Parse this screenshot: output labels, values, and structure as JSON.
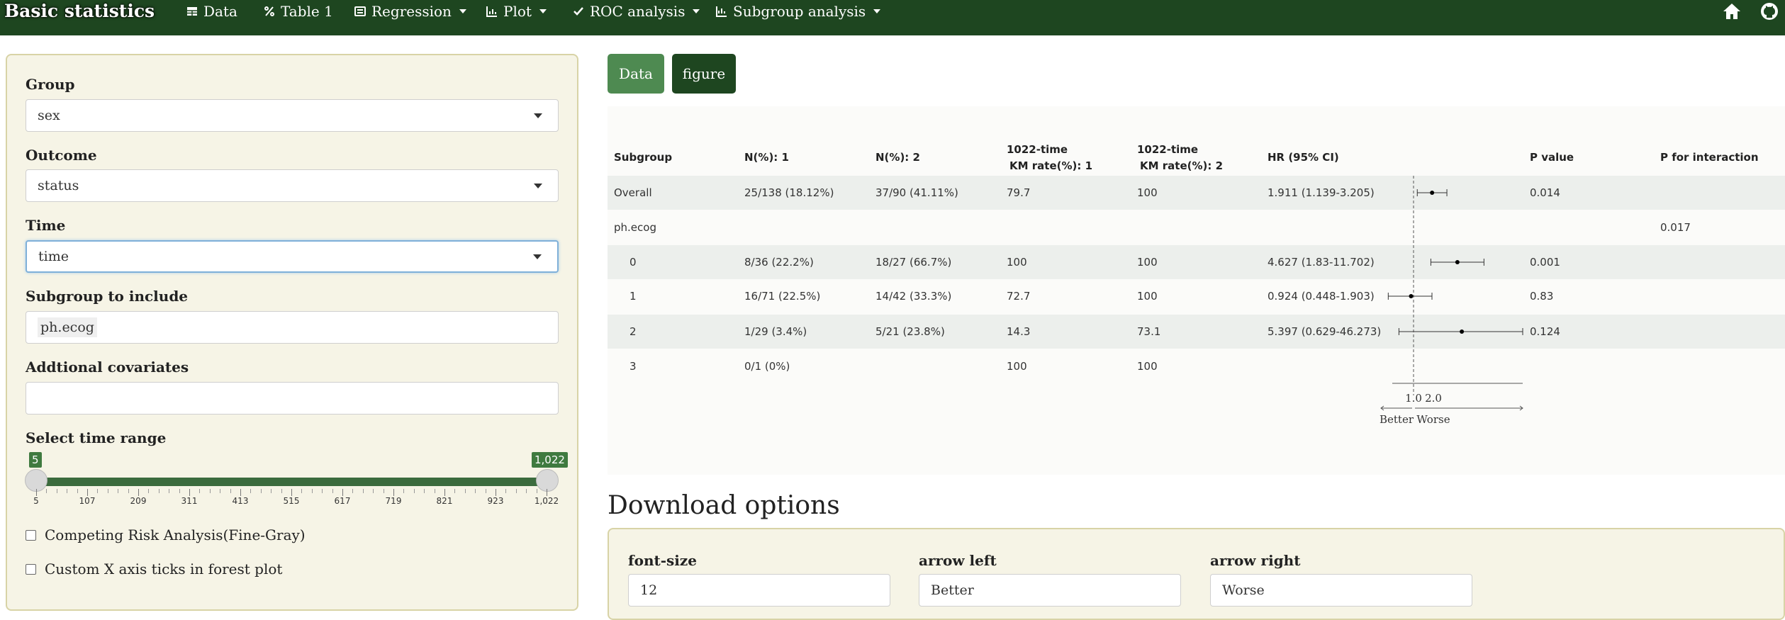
{
  "navbar": {
    "brand": "Basic statistics",
    "items": [
      {
        "label": "Data",
        "icon": "table-icon"
      },
      {
        "label": "Table 1",
        "icon": "percent-icon"
      },
      {
        "label": "Regression",
        "icon": "list-icon",
        "dropdown": true
      },
      {
        "label": "Plot",
        "icon": "bar-chart-icon",
        "dropdown": true
      },
      {
        "label": "ROC analysis",
        "icon": "check-icon",
        "dropdown": true
      },
      {
        "label": "Subgroup analysis",
        "icon": "line-chart-icon",
        "dropdown": true
      }
    ],
    "right_icons": [
      "home-icon",
      "github-icon"
    ]
  },
  "sidebar": {
    "group_label": "Group",
    "group_value": "sex",
    "outcome_label": "Outcome",
    "outcome_value": "status",
    "time_label": "Time",
    "time_value": "time",
    "subgroup_label": "Subgroup to include",
    "subgroup_tag": "ph.ecog",
    "covariates_label": "Addtional covariates",
    "covariates_value": "",
    "time_range_label": "Select time range",
    "slider": {
      "min": 5,
      "max": 1022,
      "from": 5,
      "to": 1022,
      "from_label": "5",
      "to_label": "1,022",
      "tick_labels": [
        "5",
        "107",
        "209",
        "311",
        "413",
        "515",
        "617",
        "719",
        "821",
        "923",
        "1,022"
      ]
    },
    "checkbox_competing": "Competing Risk Analysis(Fine-Gray)",
    "checkbox_custom_ticks": "Custom X axis ticks in forest plot"
  },
  "tabs": {
    "data": "Data",
    "figure": "figure"
  },
  "table": {
    "headers": {
      "subgroup": "Subgroup",
      "n1": "N(%): 1",
      "n2": "N(%): 2",
      "km1_line1": "1022-time",
      "km1_line2": "KM rate(%): 1",
      "km2_line1": "1022-time",
      "km2_line2": "KM rate(%): 2",
      "hr": "HR (95% CI)",
      "p": "P value",
      "p_int": "P for interaction"
    },
    "rows": [
      {
        "subgroup": "Overall",
        "n1": "25/138 (18.12%)",
        "n2": "37/90 (41.11%)",
        "km1": "79.7",
        "km2": "100",
        "hr": "1.911 (1.139-3.205)",
        "p": "0.014",
        "p_int": "",
        "hr_point": 1.911,
        "lo": 1.139,
        "hi": 3.205
      },
      {
        "subgroup": "ph.ecog",
        "n1": "",
        "n2": "",
        "km1": "",
        "km2": "",
        "hr": "",
        "p": "",
        "p_int": "0.017"
      },
      {
        "subgroup": "0",
        "n1": "8/36 (22.2%)",
        "n2": "18/27 (66.7%)",
        "km1": "100",
        "km2": "100",
        "hr": "4.627 (1.83-11.702)",
        "p": "0.001",
        "p_int": "",
        "hr_point": 4.627,
        "lo": 1.83,
        "hi": 11.702
      },
      {
        "subgroup": "1",
        "n1": "16/71 (22.5%)",
        "n2": "14/42 (33.3%)",
        "km1": "72.7",
        "km2": "100",
        "hr": "0.924 (0.448-1.903)",
        "p": "0.83",
        "p_int": "",
        "hr_point": 0.924,
        "lo": 0.448,
        "hi": 1.903
      },
      {
        "subgroup": "2",
        "n1": "1/29 (3.4%)",
        "n2": "5/21 (23.8%)",
        "km1": "14.3",
        "km2": "73.1",
        "hr": "5.397 (0.629-46.273)",
        "p": "0.124",
        "p_int": "",
        "hr_point": 5.397,
        "lo": 0.629,
        "hi": 46.273
      },
      {
        "subgroup": "3",
        "n1": "0/1 (0%)",
        "n2": "",
        "km1": "100",
        "km2": "100",
        "hr": "",
        "p": "",
        "p_int": ""
      }
    ]
  },
  "forest_axis": {
    "tick_labels": [
      "1.0",
      "2.0"
    ],
    "arrow_left": "Better",
    "arrow_right": "Worse"
  },
  "download": {
    "title": "Download options",
    "font_size_label": "font-size",
    "font_size_value": "12",
    "arrow_left_label": "arrow left",
    "arrow_left_value": "Better",
    "arrow_right_label": "arrow right",
    "arrow_right_value": "Worse"
  },
  "colors": {
    "navbar": "#1e4620",
    "accent": "#4e8a51",
    "sidebar_bg": "#f6f4e6"
  }
}
